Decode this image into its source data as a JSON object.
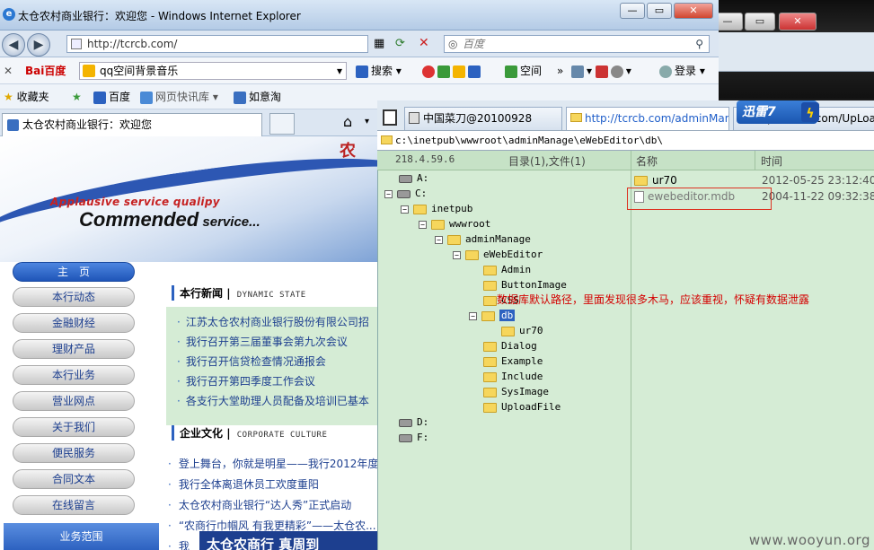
{
  "desktop": {
    "min": "—",
    "max": "▭",
    "close": "✕"
  },
  "ie": {
    "title": "太仓农村商业银行：欢迎您 - Windows Internet Explorer",
    "url": "http://tcrcb.com/",
    "search_placeholder": "百度",
    "baidu": {
      "logo": "Bai百度",
      "query": "qq空间背景音乐",
      "search_btn": "搜索",
      "space_btn": "空间",
      "login_btn": "登录"
    },
    "favbar": {
      "favorites": "收藏夹",
      "baidu": "百度",
      "webslice": "网页快讯库",
      "ruyitao": "如意淘"
    },
    "tab_title": "太仓农村商业银行：欢迎您"
  },
  "page": {
    "banner_line1": "Applausive service qualipy",
    "banner_line2_big": "Commended",
    "banner_line2_small": " service...",
    "banner_logo": "农",
    "nav": [
      "主　页",
      "本行动态",
      "金融财经",
      "理财产品",
      "本行业务",
      "营业网点",
      "关于我们",
      "便民服务",
      "合同文本",
      "在线留言"
    ],
    "biz_scope": "业务范围",
    "news_title": "本行新闻",
    "news_sub": "DYNAMIC STATE",
    "news": [
      "江苏太仓农村商业银行股份有限公司招",
      "我行召开第三届董事会第九次会议",
      "我行召开信贷检查情况通报会",
      "我行召开第四季度工作会议",
      "各支行大堂助理人员配备及培训已基本"
    ],
    "culture_title": "企业文化",
    "culture_sub": "CORPORATE CULTURE",
    "culture": [
      "登上舞台，你就是明星——我行2012年度",
      "我行全体离退休员工欢度重阳",
      "太仓农村商业银行“达人秀”正式启动",
      "“农商行巾帼风 有我更精彩”——太仓农...",
      "我"
    ],
    "promo": "太仓农商行 真周到"
  },
  "filemgr": {
    "tab1": "中国菜刀@20100928",
    "tab2": "http://tcrcb.com/adminMana...",
    "tab3": "http://tcrcb.com/UpLoadFiles",
    "xunlei": "迅雷7",
    "path": "c:\\inetpub\\wwwroot\\adminManage\\eWebEditor\\db\\",
    "ip": "218.4.59.6",
    "dir_header": "目录(1),文件(1)",
    "col_name": "名称",
    "col_time": "时间",
    "tree": {
      "a": "A:",
      "c": "C:",
      "inetpub": "inetpub",
      "wwwroot": "wwwroot",
      "adminManage": "adminManage",
      "eWebEditor": "eWebEditor",
      "Admin": "Admin",
      "ButtonImage": "ButtonImage",
      "CSS": "CSS",
      "db": "db",
      "ur70": "ur70",
      "Dialog": "Dialog",
      "Example": "Example",
      "Include": "Include",
      "SysImage": "SysImage",
      "UploadFile": "UploadFile",
      "d": "D:",
      "f": "F:"
    },
    "note": "数据库默认路径，里面发现很多木马，应该重视，怀疑有数据泄露",
    "files": [
      {
        "name": "ur70",
        "time": "2012-05-25 23:12:40"
      },
      {
        "name": "ewebeditor.mdb",
        "time": "2004-11-22 09:32:38"
      }
    ]
  },
  "watermark": "www.wooyun.org"
}
